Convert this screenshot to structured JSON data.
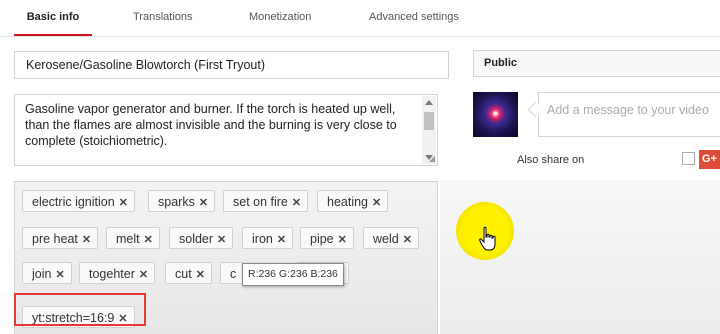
{
  "tabs": [
    {
      "label": "Basic info",
      "active": true
    },
    {
      "label": "Translations",
      "active": false
    },
    {
      "label": "Monetization",
      "active": false
    },
    {
      "label": "Advanced settings",
      "active": false
    }
  ],
  "video": {
    "title": "Kerosene/Gasoline Blowtorch (First Tryout)",
    "description": "Gasoline vapor generator and burner. If the torch is heated up well, than the flames are almost invisible and the burning is very close to complete (stoichiometric)."
  },
  "tags": [
    "electric ignition",
    "sparks",
    "set on fire",
    "heating",
    "pre heat",
    "melt",
    "solder",
    "iron",
    "pipe",
    "weld",
    "join",
    "togehter",
    "cut",
    "c",
    "",
    "yt:stretch=16:9"
  ],
  "tooltip": "R:236 G:236 B:236",
  "privacy": {
    "label": "Public"
  },
  "share": {
    "message_placeholder": "Add a message to your video",
    "also_share_label": "Also share on",
    "gplus_label": "G+"
  },
  "colors": {
    "accent": "#cc181e",
    "highlight_box": "#e53935",
    "cursor_halo": "#fff200",
    "gplus": "#dd4b39"
  },
  "icons": {
    "tag_remove": "close-icon",
    "cursor": "hand-cursor-icon",
    "share": "google-plus-icon"
  }
}
